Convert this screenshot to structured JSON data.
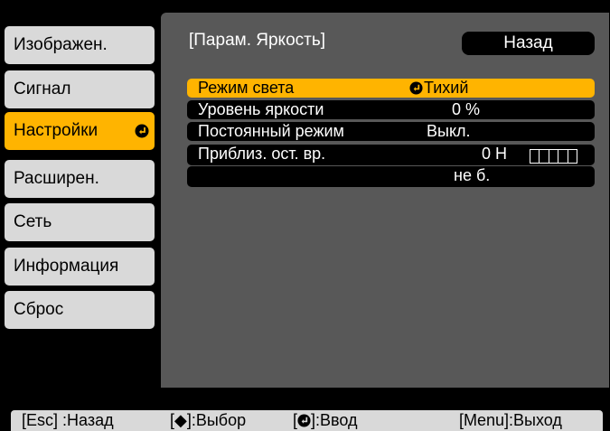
{
  "sidebar": {
    "items": [
      {
        "label": "Изображен.",
        "active": false
      },
      {
        "label": "Сигнал",
        "active": false
      },
      {
        "label": "Настройки",
        "active": true
      },
      {
        "label": "Расширен.",
        "active": false
      },
      {
        "label": "Сеть",
        "active": false
      },
      {
        "label": "Информация",
        "active": false
      },
      {
        "label": "Сброс",
        "active": false
      }
    ]
  },
  "panel": {
    "title": "[Парам. Яркость]",
    "back_label": "Назад",
    "rows": [
      {
        "label": "Режим света",
        "value": "Тихий",
        "selected": true
      },
      {
        "label": "Уровень яркости",
        "value": "0 %"
      },
      {
        "label": "Постоянный режим",
        "value": "Выкл."
      },
      {
        "label": "Приблиз. ост. вр.",
        "value": "0 Н",
        "value2": "не б.",
        "gauge_level": 0
      }
    ]
  },
  "footer": {
    "esc": "[Esc] :Назад",
    "select": "[◆]:Выбор",
    "enter": "[",
    "enter_text": "]:Ввод",
    "menu": "[Menu]:Выход"
  },
  "colors": {
    "accent": "#ffb400",
    "panel": "#585858",
    "tab": "#d9d9d9"
  }
}
